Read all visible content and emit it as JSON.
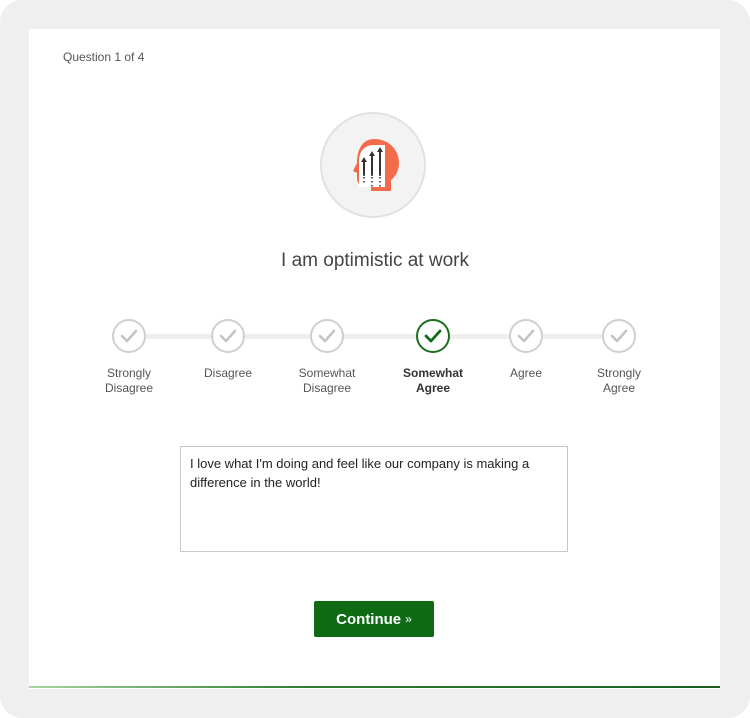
{
  "survey": {
    "progress": "Question 1 of 4",
    "question": "I am optimistic at work",
    "icon": "head-upward-arrows-icon",
    "options": [
      {
        "label_line1": "Strongly",
        "label_line2": "Disagree",
        "selected": false
      },
      {
        "label_line1": "Disagree",
        "label_line2": "",
        "selected": false
      },
      {
        "label_line1": "Somewhat",
        "label_line2": "Disagree",
        "selected": false
      },
      {
        "label_line1": "Somewhat",
        "label_line2": "Agree",
        "selected": true
      },
      {
        "label_line1": "Agree",
        "label_line2": "",
        "selected": false
      },
      {
        "label_line1": "Strongly",
        "label_line2": "Agree",
        "selected": false
      }
    ],
    "comment": "I love what I'm doing and feel like our company is making a difference in the world!",
    "continue_label": "Continue",
    "continue_chevron": "»"
  },
  "colors": {
    "accent": "#0e6b13",
    "icon_orange": "#f26b4b",
    "unselected_check": "#c4c4c4"
  }
}
